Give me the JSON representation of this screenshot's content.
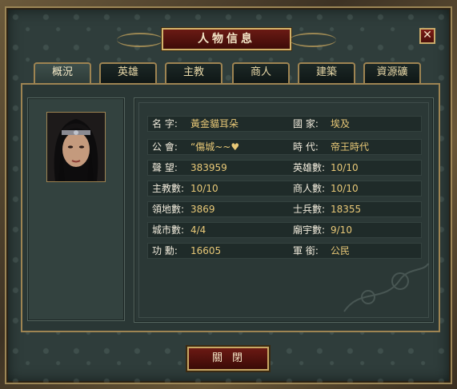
{
  "window": {
    "title": "人物信息",
    "close_label": "✕"
  },
  "tabs": [
    {
      "label": "概況",
      "active": true
    },
    {
      "label": "英雄",
      "active": false
    },
    {
      "label": "主教",
      "active": false
    },
    {
      "label": "商人",
      "active": false
    },
    {
      "label": "建築",
      "active": false
    },
    {
      "label": "資源礦",
      "active": false
    }
  ],
  "portrait": {
    "icon": "character-portrait"
  },
  "info_rows": [
    {
      "left_label": "名  字:",
      "left_value": "黃金貓耳朵",
      "right_label": "國  家:",
      "right_value": "埃及"
    },
    {
      "left_label": "公  會:",
      "left_value": "“傷城~~♥",
      "right_label": "時  代:",
      "right_value": "帝王時代"
    },
    {
      "left_label": "聲  望:",
      "left_value": "383959",
      "right_label": "英雄數:",
      "right_value": "10/10"
    },
    {
      "left_label": "主教數:",
      "left_value": "10/10",
      "right_label": "商人數:",
      "right_value": "10/10"
    },
    {
      "left_label": "領地數:",
      "left_value": "3869",
      "right_label": "士兵數:",
      "right_value": "18355"
    },
    {
      "left_label": "城市數:",
      "left_value": "4/4",
      "right_label": "廟宇數:",
      "right_value": "9/10"
    },
    {
      "left_label": "功  勳:",
      "left_value": "16605",
      "right_label": "軍  銜:",
      "right_value": "公民"
    }
  ],
  "footer": {
    "close_button_label": "關閉"
  },
  "colors": {
    "label": "#f1ebdc",
    "value": "#e8c877",
    "accent": "#9e8452"
  }
}
